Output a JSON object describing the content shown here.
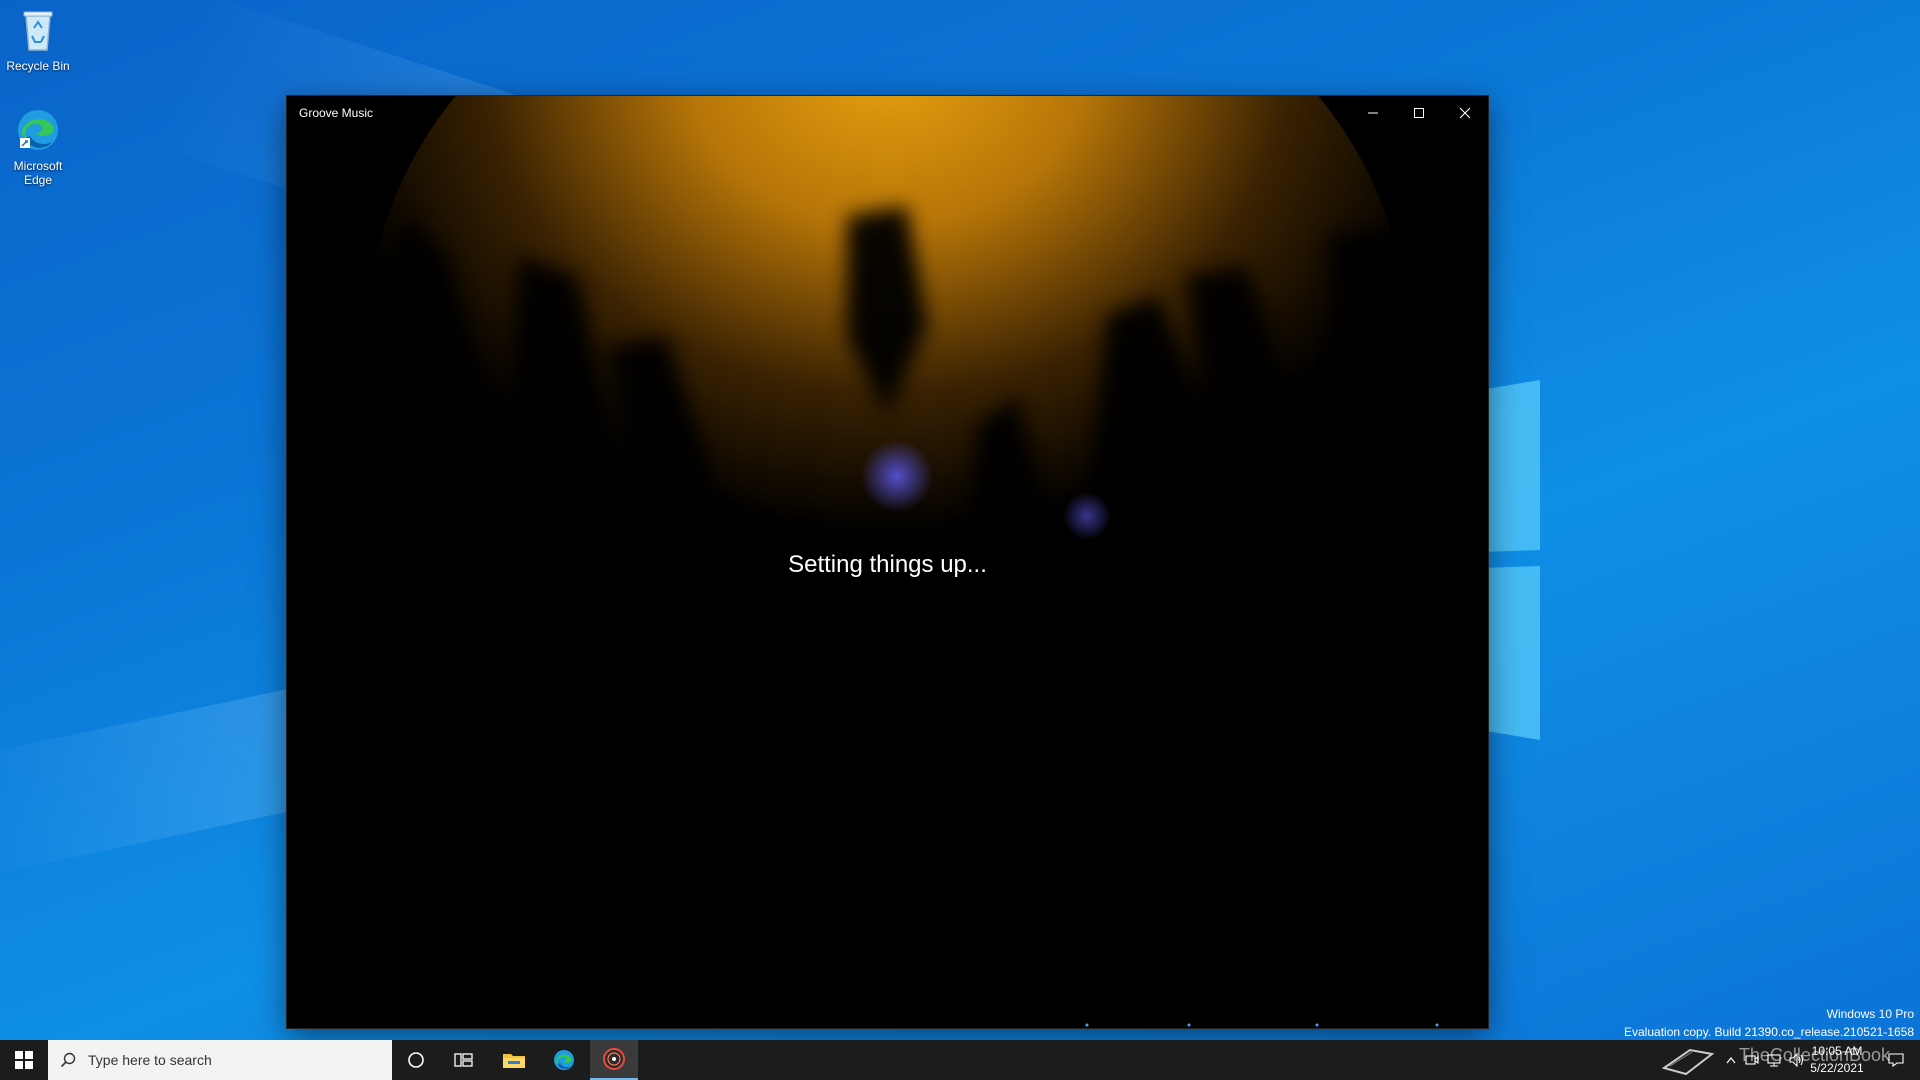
{
  "desktop": {
    "icons": [
      {
        "label": "Recycle Bin",
        "icon": "recycle-bin-icon"
      },
      {
        "label": "Microsoft Edge",
        "icon": "edge-icon"
      }
    ],
    "watermark": {
      "edition": "Windows 10 Pro",
      "build": "Evaluation copy. Build 21390.co_release.210521-1658"
    }
  },
  "window": {
    "title": "Groove Music",
    "status": "Setting things up...",
    "controls": {
      "minimize": "minimize-icon",
      "maximize": "maximize-icon",
      "close": "close-icon"
    }
  },
  "taskbar": {
    "search_placeholder": "Type here to search",
    "pinned": [
      "cortana-icon",
      "task-view-icon",
      "file-explorer-icon",
      "edge-icon",
      "groove-music-icon"
    ],
    "clock": {
      "time": "10:05 AM",
      "date": "5/22/2021"
    },
    "tray_watermark": "TheCollectionBook"
  },
  "colors": {
    "desktop_accent": "#0b78d8",
    "taskbar": "#1c1c1c",
    "active_indicator": "#76b9ed"
  }
}
